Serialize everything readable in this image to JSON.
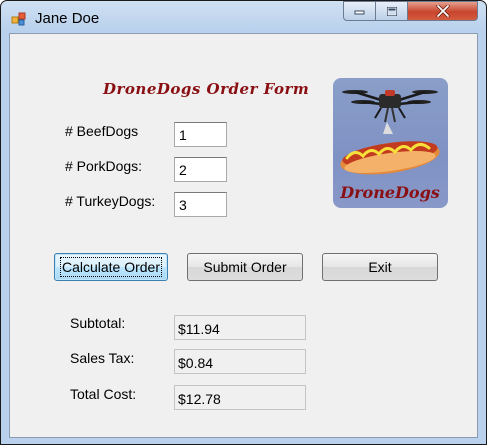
{
  "window": {
    "title": "Jane Doe"
  },
  "form": {
    "heading": "DroneDogs Order Form",
    "quantities": [
      {
        "label": "# BeefDogs",
        "value": "1"
      },
      {
        "label": "# PorkDogs:",
        "value": "2"
      },
      {
        "label": "# TurkeyDogs:",
        "value": "3"
      }
    ],
    "buttons": {
      "calculate": "Calculate Order",
      "submit": "Submit Order",
      "exit": "Exit"
    },
    "results": [
      {
        "label": "Subtotal:",
        "value": "$11.94"
      },
      {
        "label": "Sales Tax:",
        "value": "$0.84"
      },
      {
        "label": "Total Cost:",
        "value": "$12.78"
      }
    ],
    "logo": {
      "text": "DroneDogs"
    }
  },
  "colors": {
    "heading": "#8a0f12",
    "close_button": "#c8452d",
    "title_bar": "#b9d1ec"
  },
  "icons": [
    "app-icon",
    "minimize-icon",
    "maximize-icon",
    "close-icon",
    "drone-hotdog-logo"
  ]
}
